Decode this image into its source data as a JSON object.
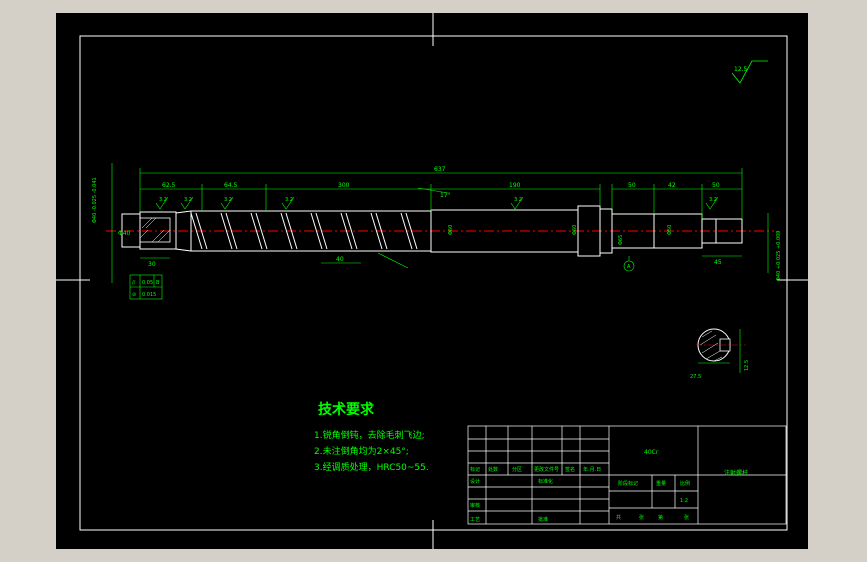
{
  "colors": {
    "background_outer": "#d4d0c8",
    "sheet": "#000000",
    "lines": "#ffffff",
    "annotations": "#00ff00",
    "centerline": "#ff0000"
  },
  "roughness": "12.5",
  "dimensions": {
    "overall": "637",
    "seg1": "62.5",
    "seg2": "64.5",
    "seg3": "300",
    "seg4": "190",
    "seg5": "50",
    "seg6": "42",
    "seg7": "50",
    "pitch": "40",
    "angle": "17°",
    "left_dia": "Φ40",
    "key_len": "30",
    "right_len": "45",
    "tol_left": "Φ40 -0.025 -0.041",
    "tol_right": "Φ40 +0.025 +0.009",
    "roughness_marks": [
      "3.2",
      "3.2",
      "3.2",
      "3.2",
      "3.2",
      "3.2",
      "3.2"
    ],
    "d60": "Φ60",
    "d60b": "Φ60",
    "d65": "Φ65",
    "d50": "Φ50",
    "section_w": "27.5",
    "section_h": "12.5",
    "section_tag": "A"
  },
  "tolerance_frame": {
    "rows": [
      {
        "symbol": "//",
        "value": "0.05",
        "ref": "B"
      },
      {
        "symbol": "⊘",
        "value": "0.015",
        "ref": ""
      }
    ]
  },
  "notes": {
    "title": "技术要求",
    "items": [
      "1.锐角倒钝，去除毛刺飞边;",
      "2.未注倒角均为2×45°;",
      "3.经调质处理，HRC50~55."
    ]
  },
  "title_block": {
    "material": "40Cr",
    "part_name": "注射螺杆",
    "scale_value": "1:2",
    "headers_row": [
      "标记",
      "处数",
      "分区",
      "更改文件号",
      "签名",
      "年.月.日"
    ],
    "role_design": "设计",
    "role_std": "标准化",
    "role_review": "审核",
    "role_process": "工艺",
    "role_approve": "批准",
    "stage_label": "阶段标记",
    "weight_label": "重量",
    "scale_label": "比例",
    "sheet_total": "共",
    "sheet_zhang": "张",
    "sheet_di": "第",
    "sheet_zhang2": "张"
  }
}
